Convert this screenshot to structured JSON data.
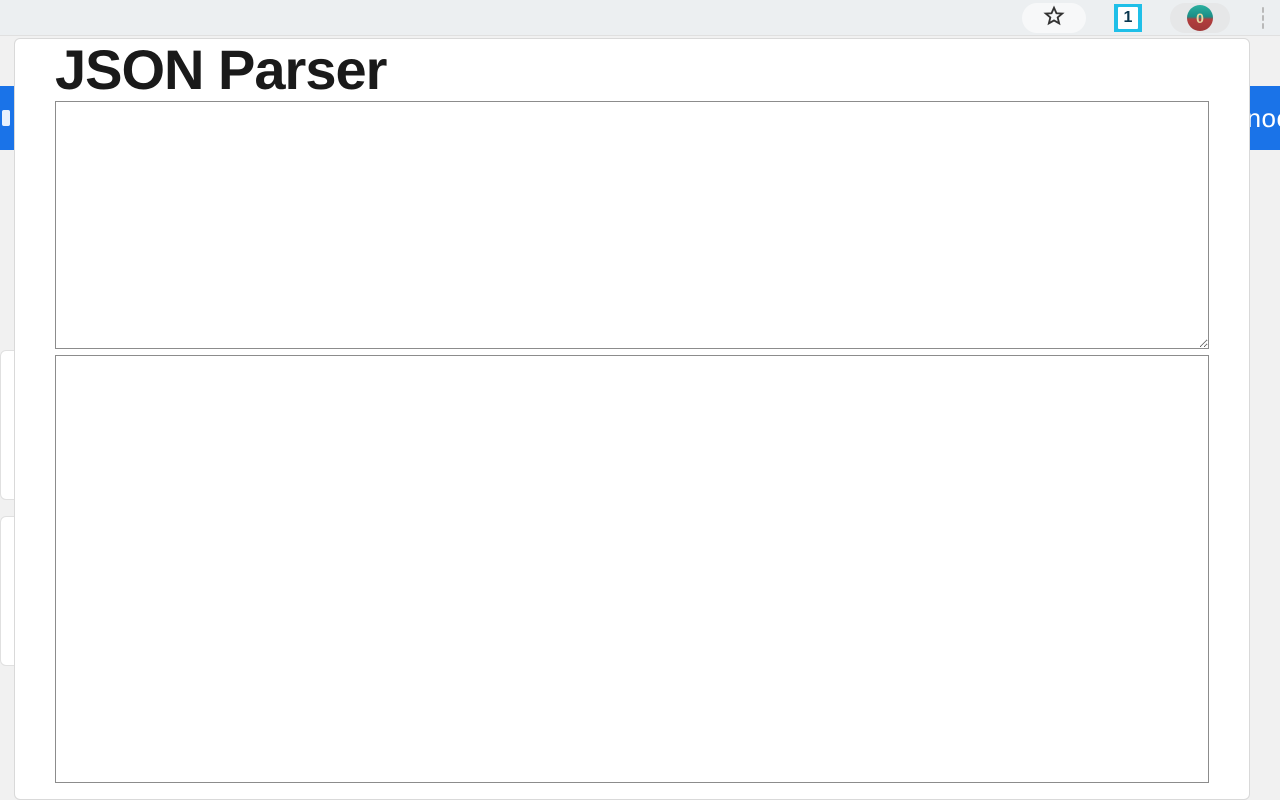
{
  "browser": {
    "extension_badge": "1",
    "avatar_initial": "0",
    "blue_banner_right": "noc"
  },
  "popup": {
    "title": "JSON Parser",
    "input_value": "",
    "input_placeholder": "",
    "output_value": ""
  }
}
